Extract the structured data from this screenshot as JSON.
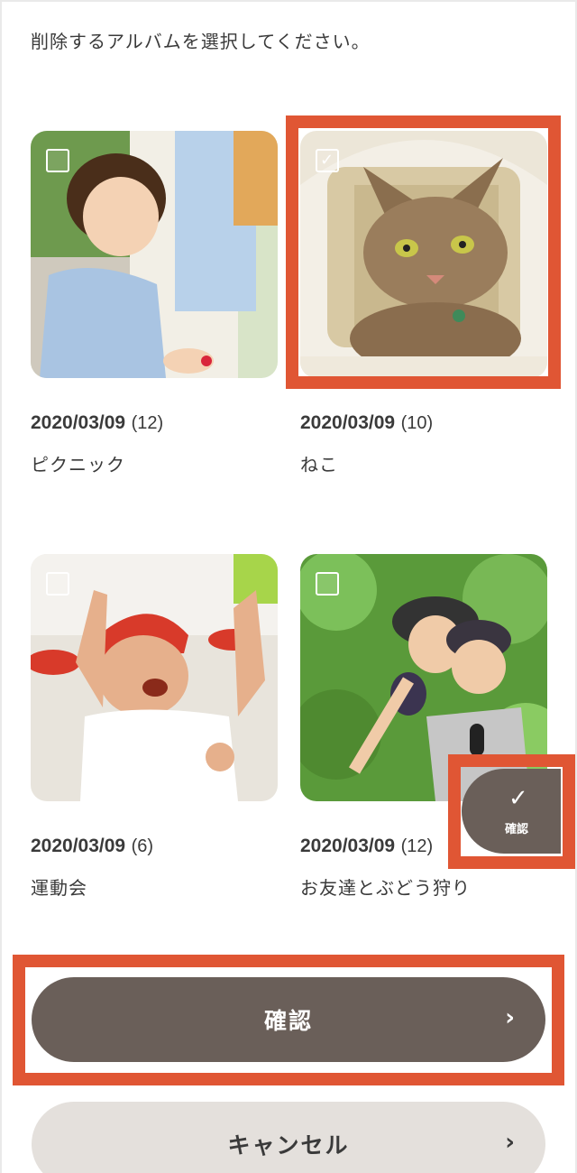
{
  "instruction": "削除するアルバムを選択してください。",
  "albums": [
    {
      "date": "2020/03/09",
      "count": "(12)",
      "name": "ピクニック",
      "selected": false,
      "image": "girl-hugging-tree-photo"
    },
    {
      "date": "2020/03/09",
      "count": "(10)",
      "name": "ねこ",
      "selected": true,
      "image": "cat-in-house-photo"
    },
    {
      "date": "2020/03/09",
      "count": "(6)",
      "name": "運動会",
      "selected": false,
      "image": "boy-cheering-photo"
    },
    {
      "date": "2020/03/09",
      "count": "(12)",
      "name": "お友達とぶどう狩り",
      "selected": false,
      "image": "grape-picking-photo"
    }
  ],
  "fab": {
    "icon": "check-icon",
    "label": "確認"
  },
  "buttons": {
    "confirm": "確認",
    "cancel": "キャンセル"
  },
  "colors": {
    "highlight": "#e05634",
    "primary": "#6a5f59",
    "secondary": "#e4e0dc"
  }
}
